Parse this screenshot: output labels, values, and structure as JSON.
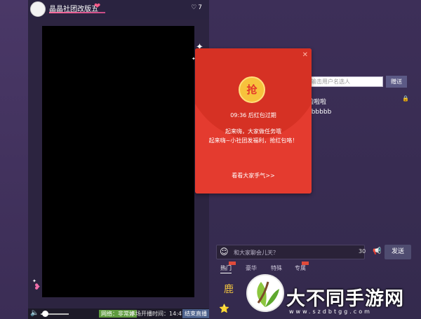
{
  "room": {
    "title": "晶晶社团改版五",
    "likes_count": "7"
  },
  "controls": {
    "network_status": "网络：非常好",
    "broadcast_time": "本场开播时间：14:47",
    "end_broadcast_label": "结束直播"
  },
  "red_packet": {
    "coin_char": "抢",
    "expire_text": "09:36 后红包过期",
    "message_line1": "起来嗨，大家做任务哦",
    "message_line2": "起来嗨~小社团发福利，抢红包咯！",
    "luck_link": "看看大家手气>>"
  },
  "right": {
    "user_search_placeholder": "输击用户名选人",
    "gift_button_label": "赠送",
    "chat_line1": "啦啦啦",
    "chat_line2": "bbbbbb",
    "chat_placeholder": "和大家聊会儿天？",
    "char_count": "30",
    "send_label": "发送",
    "tabs": [
      {
        "label": "热门"
      },
      {
        "label": "豪华"
      },
      {
        "label": "特殊"
      },
      {
        "label": "专属"
      }
    ],
    "gift_first_char": "鹿"
  },
  "watermark": {
    "title": "大不同手游网",
    "url": "www.szdbtgg.com"
  },
  "icons": {
    "heart": "heart-icon",
    "close": "close-icon",
    "volume": "volume-mute-icon",
    "emoji": "emoji-icon",
    "speaker": "speaker-icon",
    "lock": "lock-icon"
  },
  "colors": {
    "packet_red": "#e43b2f",
    "coin_gold": "#f7c23c",
    "network_green": "#5e9b3e",
    "end_button_blue": "#4a5f8a"
  }
}
